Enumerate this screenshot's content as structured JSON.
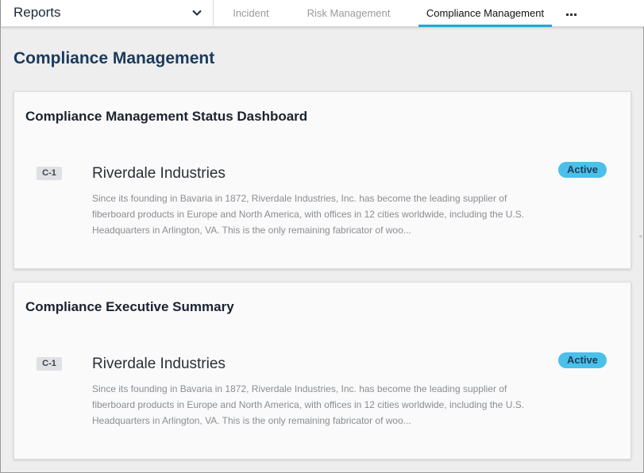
{
  "header": {
    "reports_select": "Reports",
    "tabs": [
      {
        "label": "Incident"
      },
      {
        "label": "Risk Management"
      },
      {
        "label": "Compliance Management"
      }
    ],
    "more_icon": "ellipsis-icon"
  },
  "page": {
    "title": "Compliance Management"
  },
  "cards": [
    {
      "title": "Compliance Management Status Dashboard",
      "record": {
        "id": "C-1",
        "name": "Riverdale Industries",
        "description": "Since its founding in Bavaria in 1872, Riverdale Industries, Inc. has become the leading supplier of fiberboard products in Europe and North America, with offices in 12 cities worldwide, including the U.S. Headquarters in Arlington, VA. This is the only remaining fabricator of woo...",
        "status": "Active"
      }
    },
    {
      "title": "Compliance Executive Summary",
      "record": {
        "id": "C-1",
        "name": "Riverdale Industries",
        "description": "Since its founding in Bavaria in 1872, Riverdale Industries, Inc. has become the leading supplier of fiberboard products in Europe and North America, with offices in 12 cities worldwide, including the U.S. Headquarters in Arlington, VA. This is the only remaining fabricator of woo...",
        "status": "Active"
      }
    }
  ],
  "colors": {
    "accent": "#1fa8d8",
    "status_active": "#4ac0ea",
    "title": "#1b3a5c"
  }
}
